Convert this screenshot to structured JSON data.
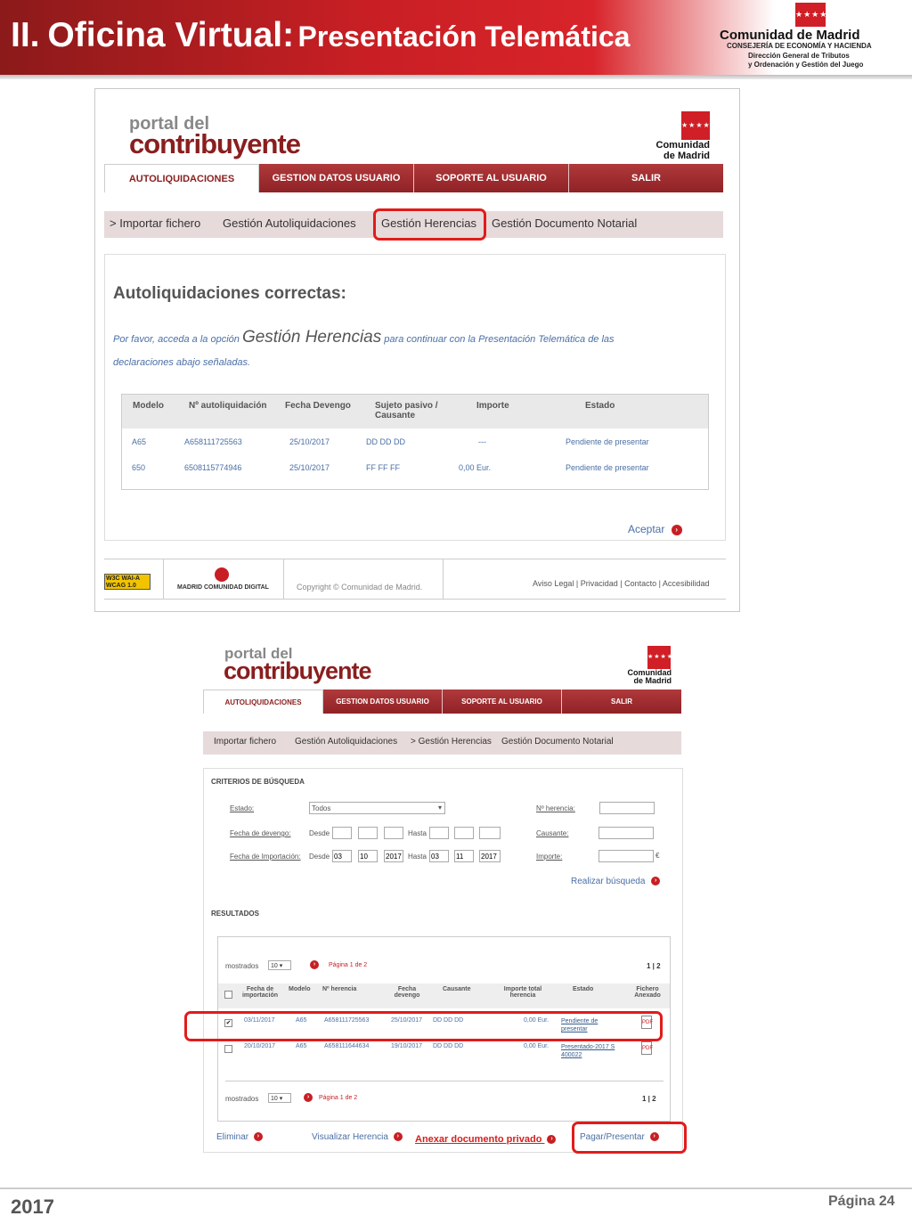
{
  "header": {
    "title_prefix": "II.",
    "title_main": "Oficina Virtual:",
    "title_sub": "Presentación Telemática",
    "org_flag": "★★★★",
    "org_name": "Comunidad de Madrid",
    "org_dept": "CONSEJERÍA DE ECONOMÍA Y HACIENDA",
    "org_div1": "Dirección General de Tributos",
    "org_div2": "y Ordenación y Gestión del Juego"
  },
  "logo": {
    "small": "portal del",
    "big": "contribuyente",
    "cm_flag": "★★★★",
    "cm_line1": "Comunidad",
    "cm_line2": "de Madrid"
  },
  "nav": [
    "AUTOLIQUIDACIONES",
    "GESTION DATOS USUARIO",
    "SOPORTE AL USUARIO",
    "SALIR"
  ],
  "shot1": {
    "subnav": [
      "> Importar fichero",
      "Gestión Autoliquidaciones",
      "Gestión Herencias",
      "Gestión Documento Notarial"
    ],
    "heading": "Autoliquidaciones correctas:",
    "msg_pre": "Por favor, acceda a la opción",
    "msg_option": "Gestión Herencias",
    "msg_post": "para continuar con la Presentación Telemática de las",
    "msg_line2": "declaraciones abajo señaladas.",
    "columns": [
      "Modelo",
      "Nº autoliquidación",
      "Fecha Devengo",
      "Sujeto pasivo / Causante",
      "Importe",
      "Estado"
    ],
    "rows": [
      [
        "A65",
        "A658111725563",
        "25/10/2017",
        "DD DD DD",
        "---",
        "Pendiente de presentar"
      ],
      [
        "650",
        "6508115774946",
        "25/10/2017",
        "FF FF FF",
        "0,00 Eur.",
        "Pendiente de presentar"
      ]
    ],
    "accept": "Aceptar",
    "footer_w3c": "W3C WAI-A WCAG 1.0",
    "footer_md": "MADRID COMUNIDAD DIGITAL",
    "footer_copy": "Copyright © Comunidad de Madrid.",
    "footer_links": "Aviso Legal | Privacidad | Contacto | Accesibilidad"
  },
  "shot2": {
    "subnav": [
      "Importar fichero",
      "Gestión Autoliquidaciones",
      "> Gestión Herencias",
      "Gestión Documento Notarial"
    ],
    "criteria_title": "CRITERIOS DE BÚSQUEDA",
    "estado_label": "Estado:",
    "estado_value": "Todos",
    "devengo_label": "Fecha de devengo:",
    "importacion_label": "Fecha de Importación:",
    "desde": "Desde",
    "hasta": "Hasta",
    "imp_desde": [
      "03",
      "10",
      "2017"
    ],
    "imp_hasta": [
      "03",
      "11",
      "2017"
    ],
    "nherencia_label": "Nº herencia:",
    "causante_label": "Causante:",
    "importe_label": "Importe:",
    "euro": "€",
    "search_btn": "Realizar búsqueda",
    "results_title": "RESULTADOS",
    "shown_label": "mostrados",
    "shown_value": "10",
    "page_text": "Página 1 de 2",
    "pages": "1 | 2",
    "columns": [
      "Fecha de importación",
      "Modelo",
      "Nº herencia",
      "Fecha devengo",
      "Causante",
      "Importe total herencia",
      "Estado",
      "Fichero Anexado"
    ],
    "rows": [
      {
        "checked": true,
        "fecha_imp": "03/11/2017",
        "modelo": "A65",
        "nherencia": "A658111725563",
        "fecha_dev": "25/10/2017",
        "causante": "DD DD DD",
        "importe": "0,00 Eur.",
        "estado": "Pendiente de presentar"
      },
      {
        "checked": false,
        "fecha_imp": "20/10/2017",
        "modelo": "A65",
        "nherencia": "A658111644634",
        "fecha_dev": "19/10/2017",
        "causante": "DD DD DD",
        "importe": "0,00 Eur.",
        "estado": "Presentado-2017 S 400022"
      }
    ],
    "actions": [
      "Eliminar",
      "Visualizar Herencia",
      "Anexar documento privado",
      "Pagar/Presentar"
    ]
  },
  "footer": {
    "year": "2017",
    "page": "Página 24"
  },
  "colors": {
    "brand_red": "#c81f24",
    "nav_red": "#9a2a2d",
    "highlight": "#e21b1b",
    "link_blue": "#355c8a"
  }
}
